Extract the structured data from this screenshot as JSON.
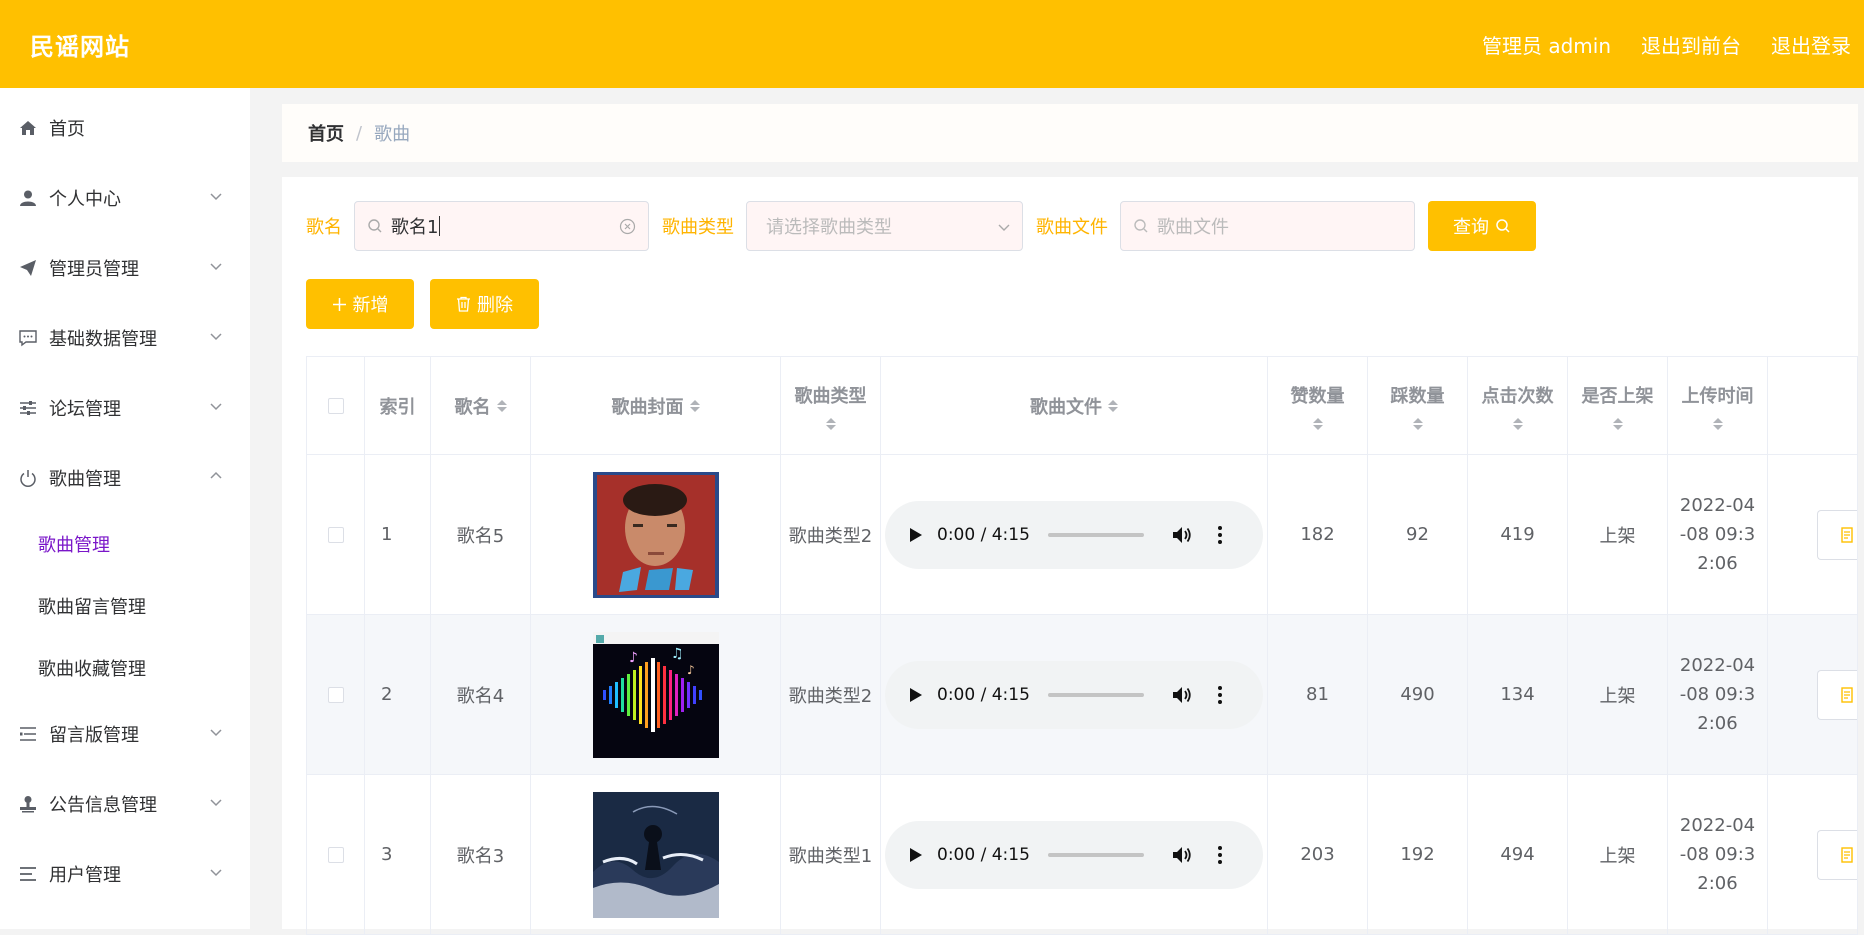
{
  "header": {
    "brand": "民谣网站",
    "admin_label": "管理员 admin",
    "front_label": "退出到前台",
    "logout_label": "退出登录"
  },
  "sidebar": {
    "items": [
      {
        "label": "首页",
        "icon": "home-icon"
      },
      {
        "label": "个人中心",
        "icon": "user-icon"
      },
      {
        "label": "管理员管理",
        "icon": "send-icon"
      },
      {
        "label": "基础数据管理",
        "icon": "chat-icon"
      },
      {
        "label": "论坛管理",
        "icon": "sliders-icon"
      },
      {
        "label": "歌曲管理",
        "icon": "power-icon"
      },
      {
        "label": "留言版管理",
        "icon": "list-icon"
      },
      {
        "label": "公告信息管理",
        "icon": "stamp-icon"
      },
      {
        "label": "用户管理",
        "icon": "menu-icon"
      }
    ],
    "sub_items": [
      {
        "label": "歌曲管理"
      },
      {
        "label": "歌曲留言管理"
      },
      {
        "label": "歌曲收藏管理"
      }
    ]
  },
  "breadcrumb": {
    "home": "首页",
    "separator": "/",
    "current": "歌曲"
  },
  "search": {
    "name_label": "歌名",
    "name_value": "歌名1",
    "type_label": "歌曲类型",
    "type_placeholder": "请选择歌曲类型",
    "file_label": "歌曲文件",
    "file_placeholder": "歌曲文件",
    "query_label": "查询"
  },
  "actions": {
    "add_label": "新增",
    "delete_label": "删除"
  },
  "table": {
    "headers": {
      "index": "索引",
      "name": "歌名",
      "cover": "歌曲封面",
      "type": "歌曲类型",
      "file": "歌曲文件",
      "likes": "赞数量",
      "dislikes": "踩数量",
      "clicks": "点击次数",
      "on_shelf": "是否上架",
      "upload_time": "上传时间"
    },
    "rows": [
      {
        "index": "1",
        "name": "歌名5",
        "type": "歌曲类型2",
        "audio_time": "0:00 / 4:15",
        "likes": "182",
        "dislikes": "92",
        "clicks": "419",
        "on_shelf": "上架",
        "upload_time": "2022-04-08 09:32:06",
        "cover": "cover-portrait"
      },
      {
        "index": "2",
        "name": "歌名4",
        "type": "歌曲类型2",
        "audio_time": "0:00 / 4:15",
        "likes": "81",
        "dislikes": "490",
        "clicks": "134",
        "on_shelf": "上架",
        "upload_time": "2022-04-08 09:32:06",
        "cover": "cover-soundwave"
      },
      {
        "index": "3",
        "name": "歌名3",
        "type": "歌曲类型1",
        "audio_time": "0:00 / 4:15",
        "likes": "203",
        "dislikes": "192",
        "clicks": "494",
        "on_shelf": "上架",
        "upload_time": "2022-04-08 09:32:06",
        "cover": "cover-ocean"
      }
    ]
  },
  "colors": {
    "accent": "#ffc000",
    "active_menu": "#7a16c9",
    "label": "#ffb400"
  }
}
